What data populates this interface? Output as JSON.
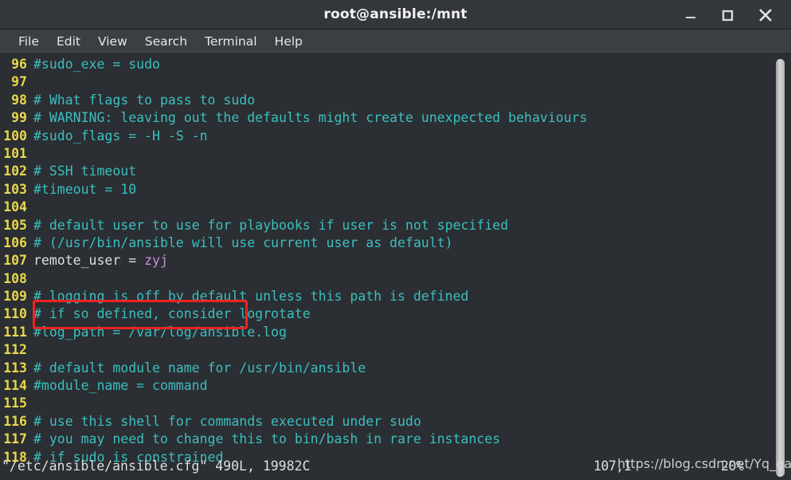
{
  "window": {
    "title": "root@ansible:/mnt",
    "controls": [
      {
        "name": "minimize",
        "label": "_"
      },
      {
        "name": "maximize",
        "label": "□"
      },
      {
        "name": "close",
        "label": "✕"
      }
    ]
  },
  "menubar": {
    "items": [
      {
        "label": "File"
      },
      {
        "label": "Edit"
      },
      {
        "label": "View"
      },
      {
        "label": "Search"
      },
      {
        "label": "Terminal"
      },
      {
        "label": "Help"
      }
    ]
  },
  "editor": {
    "lines": [
      {
        "no": "96",
        "segments": [
          {
            "style": "comment",
            "text": "#sudo_exe = sudo"
          }
        ]
      },
      {
        "no": "97",
        "segments": []
      },
      {
        "no": "98",
        "segments": [
          {
            "style": "comment",
            "text": "# What flags to pass to sudo"
          }
        ]
      },
      {
        "no": "99",
        "segments": [
          {
            "style": "comment",
            "text": "# WARNING: leaving out the defaults might create unexpected behaviours"
          }
        ]
      },
      {
        "no": "100",
        "segments": [
          {
            "style": "comment",
            "text": "#sudo_flags = -H -S -n"
          }
        ]
      },
      {
        "no": "101",
        "segments": []
      },
      {
        "no": "102",
        "segments": [
          {
            "style": "comment",
            "text": "# SSH timeout"
          }
        ]
      },
      {
        "no": "103",
        "segments": [
          {
            "style": "comment",
            "text": "#timeout = 10"
          }
        ]
      },
      {
        "no": "104",
        "segments": []
      },
      {
        "no": "105",
        "segments": [
          {
            "style": "comment",
            "text": "# default user to use for playbooks if user is not specified"
          }
        ]
      },
      {
        "no": "106",
        "segments": [
          {
            "style": "comment",
            "text": "# (/usr/bin/ansible will use current user as default)"
          }
        ]
      },
      {
        "no": "107",
        "segments": [
          {
            "style": "plain",
            "text": "remote_user = "
          },
          {
            "style": "value",
            "text": "zyj"
          }
        ]
      },
      {
        "no": "108",
        "segments": []
      },
      {
        "no": "109",
        "segments": [
          {
            "style": "comment",
            "text": "# logging is off by default unless this path is defined"
          }
        ]
      },
      {
        "no": "110",
        "segments": [
          {
            "style": "comment",
            "text": "# if so defined, consider logrotate"
          }
        ]
      },
      {
        "no": "111",
        "segments": [
          {
            "style": "comment",
            "text": "#log_path = /var/log/ansible.log"
          }
        ]
      },
      {
        "no": "112",
        "segments": []
      },
      {
        "no": "113",
        "segments": [
          {
            "style": "comment",
            "text": "# default module name for /usr/bin/ansible"
          }
        ]
      },
      {
        "no": "114",
        "segments": [
          {
            "style": "comment",
            "text": "#module_name = command"
          }
        ]
      },
      {
        "no": "115",
        "segments": []
      },
      {
        "no": "116",
        "segments": [
          {
            "style": "comment",
            "text": "# use this shell for commands executed under sudo"
          }
        ]
      },
      {
        "no": "117",
        "segments": [
          {
            "style": "comment",
            "text": "# you may need to change this to bin/bash in rare instances"
          }
        ]
      },
      {
        "no": "118",
        "segments": [
          {
            "style": "comment",
            "text": "# if sudo is constrained"
          }
        ]
      }
    ]
  },
  "statusline": {
    "file": "\"/etc/ansible/ansible.cfg\" 490L, 19982C",
    "position": "107,1",
    "percent": "20%"
  },
  "annotation": {
    "target_line": "107",
    "color": "#ee2222"
  },
  "watermark": {
    "text": "https://blog.csdn.net/Yq_gang"
  },
  "colors": {
    "titlebar_bg": "#33363b",
    "menubar_bg": "#3b3e43",
    "terminal_bg": "#2b2e33",
    "linenumber": "#e8d84b",
    "comment": "#3bbfbf",
    "plain_text": "#dfdfdf",
    "value_text": "#c792d8",
    "annotation": "#ee2222",
    "scrollbar_thumb": "#d6d6d6"
  }
}
